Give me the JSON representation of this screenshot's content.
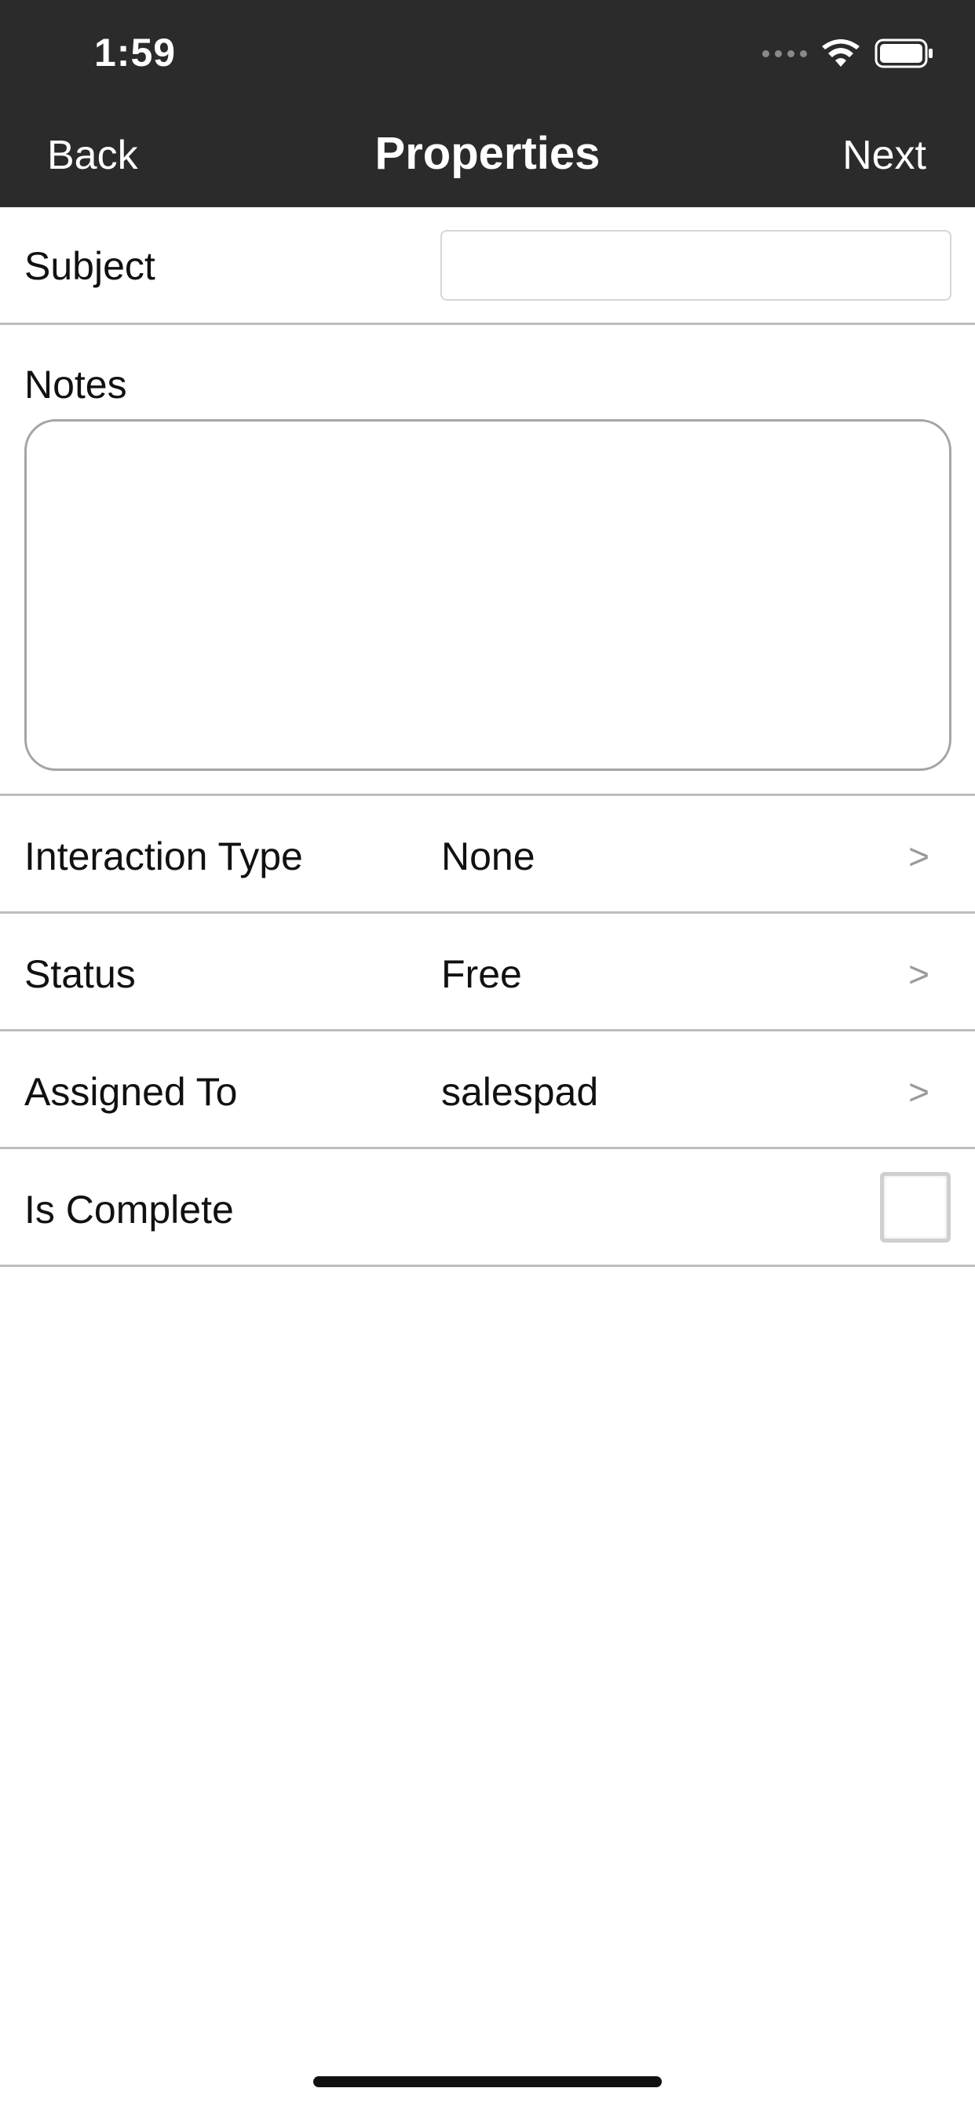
{
  "status_bar": {
    "time": "1:59",
    "icons": [
      "cellular-signal-icon",
      "wifi-icon",
      "battery-icon"
    ]
  },
  "nav": {
    "back_label": "Back",
    "title": "Properties",
    "next_label": "Next"
  },
  "form": {
    "subject": {
      "label": "Subject",
      "value": ""
    },
    "notes": {
      "label": "Notes",
      "value": ""
    },
    "interaction_type": {
      "label": "Interaction Type",
      "value": "None",
      "chevron": ">"
    },
    "status": {
      "label": "Status",
      "value": "Free",
      "chevron": ">"
    },
    "assigned_to": {
      "label": "Assigned To",
      "value": "salespad",
      "chevron": ">"
    },
    "is_complete": {
      "label": "Is Complete",
      "checked": false
    }
  },
  "colors": {
    "header_bg": "#2b2b2b",
    "header_text": "#ffffff",
    "separator": "#bdbdbd",
    "chevron": "#9a9a9a"
  }
}
